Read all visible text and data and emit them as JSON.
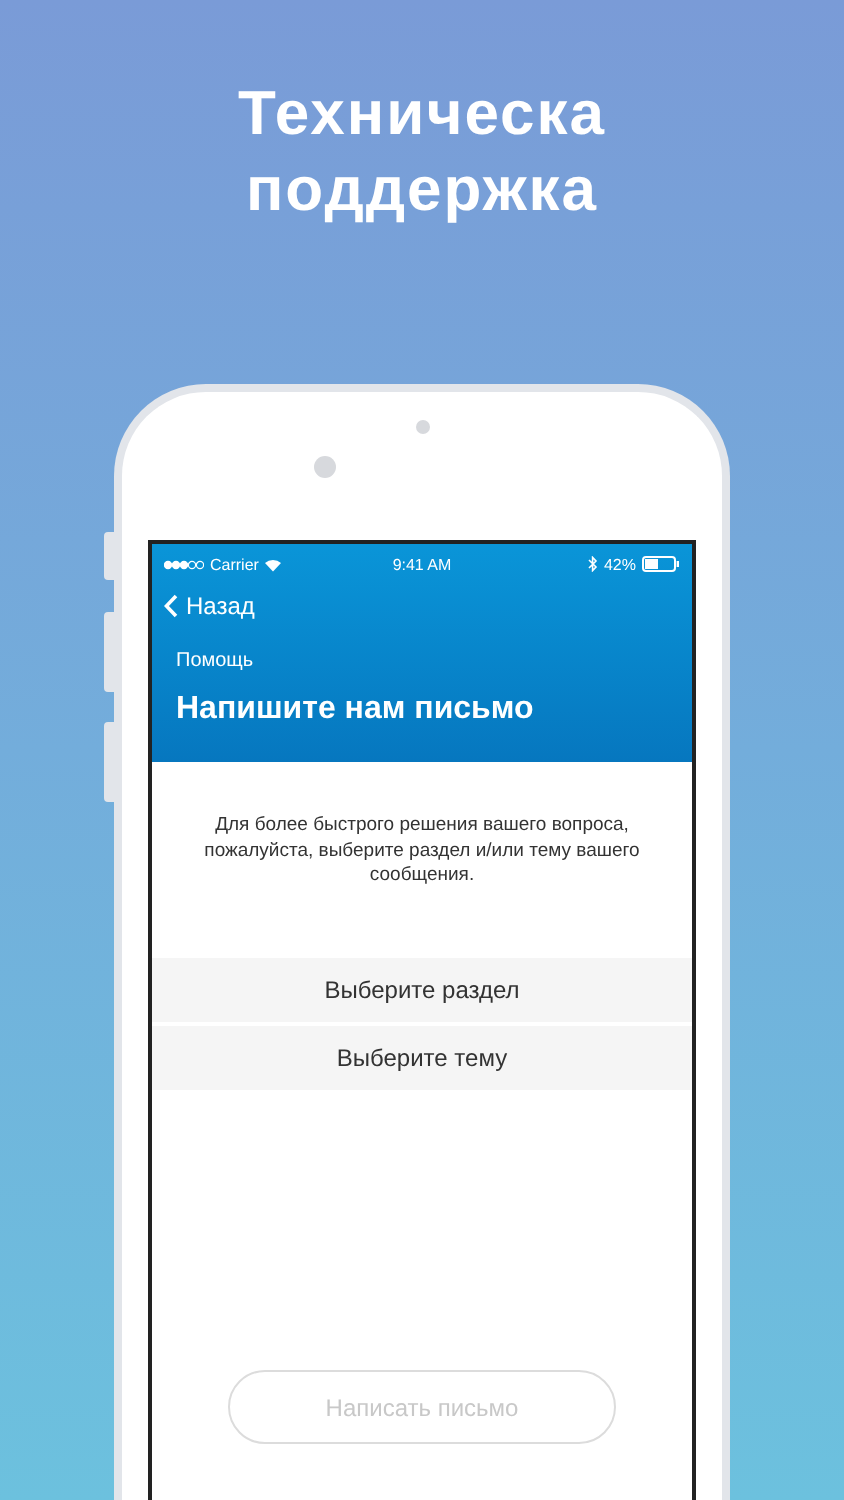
{
  "headline": "Техническа поддержка",
  "status_bar": {
    "carrier": "Carrier",
    "time": "9:41 AM",
    "battery": "42%"
  },
  "nav": {
    "back": "Назад"
  },
  "header": {
    "subtitle": "Помощь",
    "title": "Напишите нам письмо"
  },
  "intro": "Для более быстрого решения вашего вопроса, пожалуйста, выберите раздел и/или тему вашего сообщения.",
  "pickers": [
    {
      "label": "Выберите раздел"
    },
    {
      "label": "Выберите тему"
    }
  ],
  "submit": {
    "label": "Написать письмо",
    "disabled": true
  }
}
